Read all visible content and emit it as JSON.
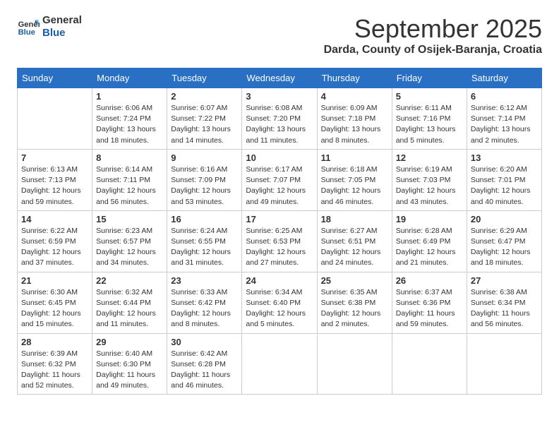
{
  "header": {
    "logo_line1": "General",
    "logo_line2": "Blue",
    "month": "September 2025",
    "location": "Darda, County of Osijek-Baranja, Croatia"
  },
  "days_of_week": [
    "Sunday",
    "Monday",
    "Tuesday",
    "Wednesday",
    "Thursday",
    "Friday",
    "Saturday"
  ],
  "weeks": [
    [
      {
        "day": "",
        "info": ""
      },
      {
        "day": "1",
        "info": "Sunrise: 6:06 AM\nSunset: 7:24 PM\nDaylight: 13 hours\nand 18 minutes."
      },
      {
        "day": "2",
        "info": "Sunrise: 6:07 AM\nSunset: 7:22 PM\nDaylight: 13 hours\nand 14 minutes."
      },
      {
        "day": "3",
        "info": "Sunrise: 6:08 AM\nSunset: 7:20 PM\nDaylight: 13 hours\nand 11 minutes."
      },
      {
        "day": "4",
        "info": "Sunrise: 6:09 AM\nSunset: 7:18 PM\nDaylight: 13 hours\nand 8 minutes."
      },
      {
        "day": "5",
        "info": "Sunrise: 6:11 AM\nSunset: 7:16 PM\nDaylight: 13 hours\nand 5 minutes."
      },
      {
        "day": "6",
        "info": "Sunrise: 6:12 AM\nSunset: 7:14 PM\nDaylight: 13 hours\nand 2 minutes."
      }
    ],
    [
      {
        "day": "7",
        "info": "Sunrise: 6:13 AM\nSunset: 7:13 PM\nDaylight: 12 hours\nand 59 minutes."
      },
      {
        "day": "8",
        "info": "Sunrise: 6:14 AM\nSunset: 7:11 PM\nDaylight: 12 hours\nand 56 minutes."
      },
      {
        "day": "9",
        "info": "Sunrise: 6:16 AM\nSunset: 7:09 PM\nDaylight: 12 hours\nand 53 minutes."
      },
      {
        "day": "10",
        "info": "Sunrise: 6:17 AM\nSunset: 7:07 PM\nDaylight: 12 hours\nand 49 minutes."
      },
      {
        "day": "11",
        "info": "Sunrise: 6:18 AM\nSunset: 7:05 PM\nDaylight: 12 hours\nand 46 minutes."
      },
      {
        "day": "12",
        "info": "Sunrise: 6:19 AM\nSunset: 7:03 PM\nDaylight: 12 hours\nand 43 minutes."
      },
      {
        "day": "13",
        "info": "Sunrise: 6:20 AM\nSunset: 7:01 PM\nDaylight: 12 hours\nand 40 minutes."
      }
    ],
    [
      {
        "day": "14",
        "info": "Sunrise: 6:22 AM\nSunset: 6:59 PM\nDaylight: 12 hours\nand 37 minutes."
      },
      {
        "day": "15",
        "info": "Sunrise: 6:23 AM\nSunset: 6:57 PM\nDaylight: 12 hours\nand 34 minutes."
      },
      {
        "day": "16",
        "info": "Sunrise: 6:24 AM\nSunset: 6:55 PM\nDaylight: 12 hours\nand 31 minutes."
      },
      {
        "day": "17",
        "info": "Sunrise: 6:25 AM\nSunset: 6:53 PM\nDaylight: 12 hours\nand 27 minutes."
      },
      {
        "day": "18",
        "info": "Sunrise: 6:27 AM\nSunset: 6:51 PM\nDaylight: 12 hours\nand 24 minutes."
      },
      {
        "day": "19",
        "info": "Sunrise: 6:28 AM\nSunset: 6:49 PM\nDaylight: 12 hours\nand 21 minutes."
      },
      {
        "day": "20",
        "info": "Sunrise: 6:29 AM\nSunset: 6:47 PM\nDaylight: 12 hours\nand 18 minutes."
      }
    ],
    [
      {
        "day": "21",
        "info": "Sunrise: 6:30 AM\nSunset: 6:45 PM\nDaylight: 12 hours\nand 15 minutes."
      },
      {
        "day": "22",
        "info": "Sunrise: 6:32 AM\nSunset: 6:44 PM\nDaylight: 12 hours\nand 11 minutes."
      },
      {
        "day": "23",
        "info": "Sunrise: 6:33 AM\nSunset: 6:42 PM\nDaylight: 12 hours\nand 8 minutes."
      },
      {
        "day": "24",
        "info": "Sunrise: 6:34 AM\nSunset: 6:40 PM\nDaylight: 12 hours\nand 5 minutes."
      },
      {
        "day": "25",
        "info": "Sunrise: 6:35 AM\nSunset: 6:38 PM\nDaylight: 12 hours\nand 2 minutes."
      },
      {
        "day": "26",
        "info": "Sunrise: 6:37 AM\nSunset: 6:36 PM\nDaylight: 11 hours\nand 59 minutes."
      },
      {
        "day": "27",
        "info": "Sunrise: 6:38 AM\nSunset: 6:34 PM\nDaylight: 11 hours\nand 56 minutes."
      }
    ],
    [
      {
        "day": "28",
        "info": "Sunrise: 6:39 AM\nSunset: 6:32 PM\nDaylight: 11 hours\nand 52 minutes."
      },
      {
        "day": "29",
        "info": "Sunrise: 6:40 AM\nSunset: 6:30 PM\nDaylight: 11 hours\nand 49 minutes."
      },
      {
        "day": "30",
        "info": "Sunrise: 6:42 AM\nSunset: 6:28 PM\nDaylight: 11 hours\nand 46 minutes."
      },
      {
        "day": "",
        "info": ""
      },
      {
        "day": "",
        "info": ""
      },
      {
        "day": "",
        "info": ""
      },
      {
        "day": "",
        "info": ""
      }
    ]
  ]
}
